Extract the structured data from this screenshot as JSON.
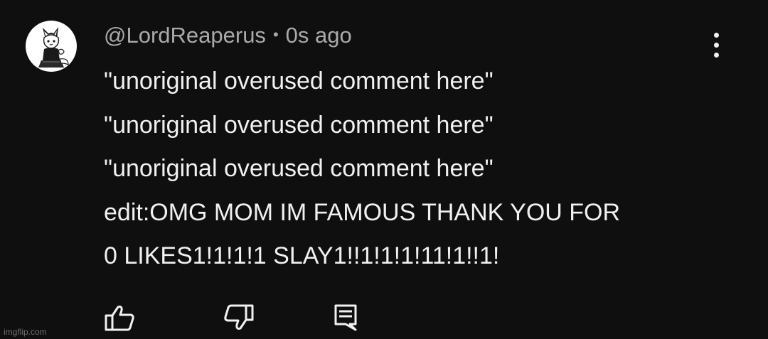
{
  "comment": {
    "author": "@LordReaperus",
    "separator": "•",
    "timestamp": "0s ago",
    "lines": [
      "\"unoriginal overused comment here\"",
      "\"unoriginal overused comment here\"",
      "\"unoriginal overused comment here\"",
      "edit:OMG MOM IM FAMOUS THANK YOU FOR",
      "0 LIKES1!1!1!1 SLAY1!!1!1!1!11!1!!1!"
    ],
    "actions": {
      "like_icon": "thumbs-up-icon",
      "dislike_icon": "thumbs-down-icon",
      "reply_icon": "reply-comment-icon"
    }
  },
  "watermark": "imgflip.com",
  "colors": {
    "background": "#0f0f0f",
    "text_primary": "#f1f1f1",
    "text_secondary": "#aaaaaa",
    "avatar_background": "#ffffff"
  }
}
